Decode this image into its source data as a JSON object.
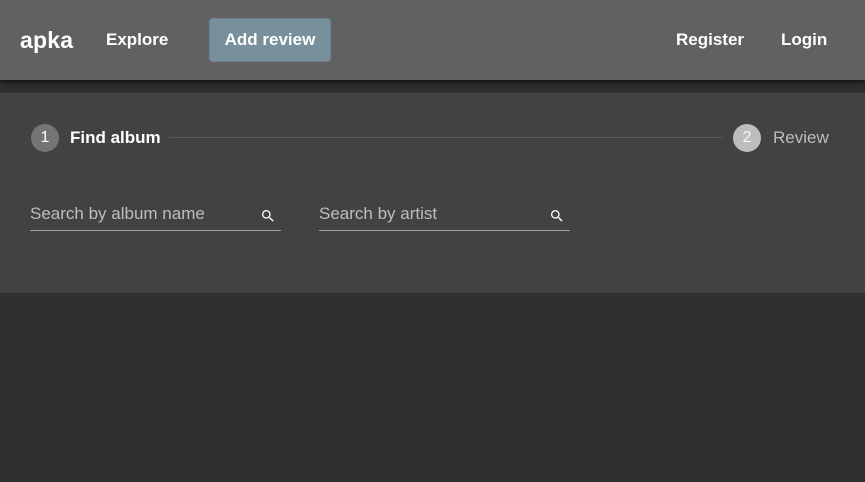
{
  "appbar": {
    "brand": "apka",
    "nav": {
      "explore": "Explore",
      "add_review": "Add review",
      "register": "Register",
      "login": "Login"
    }
  },
  "stepper": {
    "steps": [
      {
        "number": "1",
        "label": "Find album",
        "active": true
      },
      {
        "number": "2",
        "label": "Review",
        "active": false
      }
    ]
  },
  "search": {
    "album": {
      "placeholder": "Search by album name",
      "value": "",
      "icon": "search-icon"
    },
    "artist": {
      "placeholder": "Search by artist",
      "value": "",
      "icon": "search-icon"
    }
  },
  "colors": {
    "appbar": "#616161",
    "accent_button": "#78909c",
    "panel": "#424242",
    "background": "#303030",
    "active_step": "#757575",
    "inactive_step": "#bdbdbd"
  }
}
